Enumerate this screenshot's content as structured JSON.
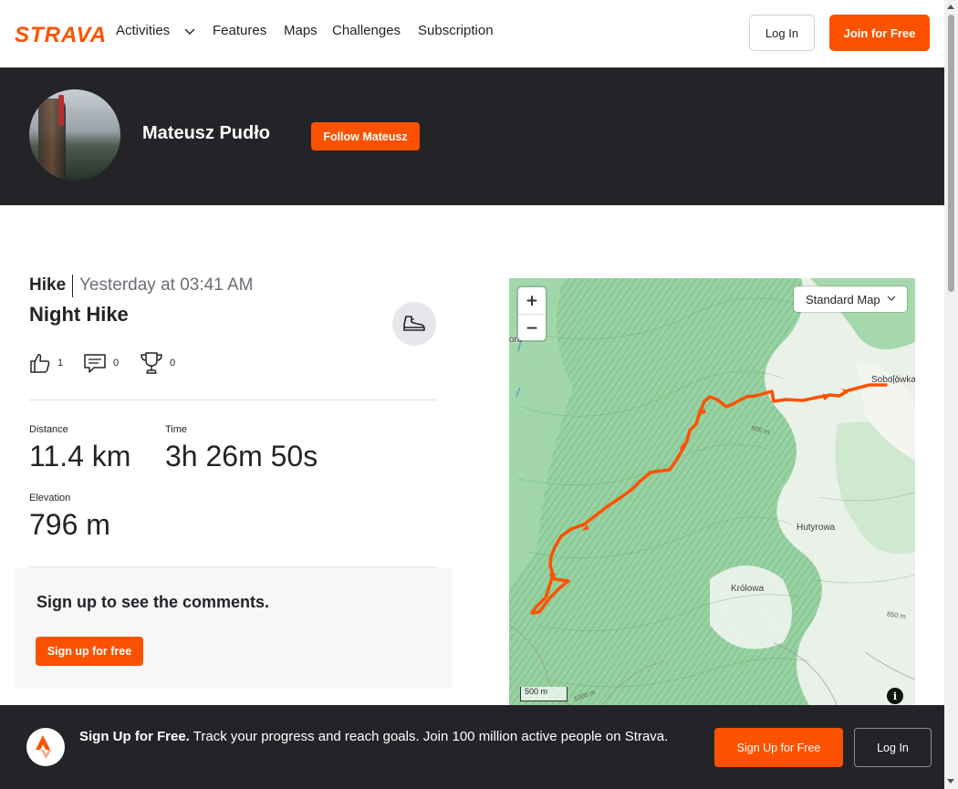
{
  "nav": {
    "logo": "STRAVA",
    "items": [
      "Activities",
      "Features",
      "Maps",
      "Challenges",
      "Subscription"
    ],
    "login_label": "Log In",
    "join_label": "Join for Free"
  },
  "profile": {
    "athlete_name": "Mateusz Pudło",
    "follow_label": "Follow Mateusz"
  },
  "activity": {
    "type": "Hike",
    "time": "Yesterday at 03:41 AM",
    "name": "Night Hike",
    "kudos": "1",
    "comments": "0",
    "achievements": "0",
    "stats": [
      {
        "label": "Distance",
        "value": "11.4 km"
      },
      {
        "label": "Time",
        "value": "3h 26m 50s"
      },
      {
        "label": "Elevation",
        "value": "796 m"
      }
    ]
  },
  "comments": {
    "title": "Sign up to see the comments.",
    "signup_label": "Sign up for free"
  },
  "map": {
    "style_selector": "Standard Map",
    "zoom_in": "+",
    "zoom_out": "−",
    "scale": "500 m",
    "info": "i",
    "places": [
      "Sobolówka",
      "Hutyrowa",
      "Królowa",
      "ora"
    ],
    "contours": [
      "900 m",
      "850 m",
      "1000 m"
    ],
    "route_color": "#fc5200"
  },
  "banner": {
    "headline": "Sign Up for Free.",
    "text": "Track your progress and reach goals. Join 100 million active people on Strava.",
    "signup_label": "Sign Up for Free",
    "login_label": "Log In"
  },
  "colors": {
    "brand": "#fc5200",
    "dark": "#242428"
  }
}
